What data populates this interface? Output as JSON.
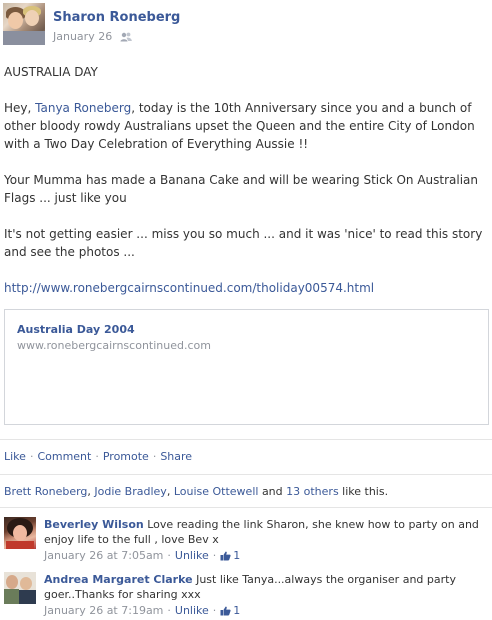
{
  "post": {
    "author": "Sharon Roneberg",
    "date": "January 26",
    "body": {
      "title": "AUSTRALIA DAY",
      "p1_prefix": "Hey, ",
      "p1_tag": "Tanya Roneberg",
      "p1_suffix": ", today is the 10th Anniversary since you and a bunch of other bloody rowdy Australians upset the Queen and the entire City of London with a Two Day Celebration of Everything Aussie !!",
      "p2": "Your Mumma has made a Banana Cake and will be wearing Stick On Australian Flags ... just like you",
      "p3": "It's not getting easier ... miss you so much ... and it was 'nice' to read this story and see the photos ...",
      "link": "http://www.ronebergcairnscontinued.com/tholiday00574.html"
    },
    "link_card": {
      "title": "Australia Day 2004",
      "url": "www.ronebergcairnscontinued.com"
    }
  },
  "actions": {
    "like": "Like",
    "comment": "Comment",
    "promote": "Promote",
    "share": "Share",
    "separator": "·"
  },
  "likes": {
    "name1": "Brett Roneberg",
    "name2": "Jodie Bradley",
    "name3": "Louise Ottewell",
    "and": "and",
    "others": "13 others",
    "suffix": "like this.",
    "comma": ","
  },
  "comments": [
    {
      "author": "Beverley Wilson",
      "text": "Love reading the link Sharon, she knew how to party on and enjoy life to the full , love Bev x",
      "time": "January 26 at 7:05am",
      "unlike": "Unlike",
      "like_count": "1"
    },
    {
      "author": "Andrea Margaret Clarke",
      "text": "Just like Tanya...always the organiser and party goer..Thanks for sharing xxx",
      "time": "January 26 at 7:19am",
      "unlike": "Unlike",
      "like_count": "1"
    }
  ],
  "colors": {
    "link": "#3b5998",
    "meta": "#90949c",
    "text": "#333333",
    "border": "#d3d6db"
  },
  "icons": {
    "audience": "friends-icon",
    "like": "thumbs-up-icon"
  }
}
